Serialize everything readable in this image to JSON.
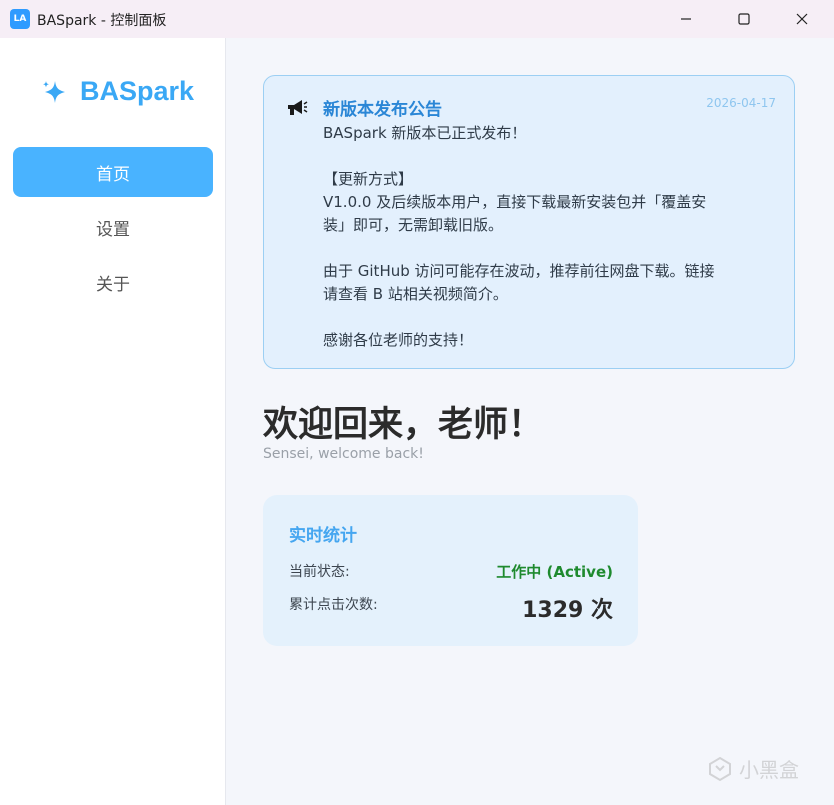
{
  "window": {
    "title": "BASpark - 控制面板",
    "app_icon_text": "LA"
  },
  "sidebar": {
    "logo": "BASpark",
    "items": [
      {
        "label": "首页",
        "active": true
      },
      {
        "label": "设置",
        "active": false
      },
      {
        "label": "关于",
        "active": false
      }
    ]
  },
  "announcement": {
    "title": "新版本发布公告",
    "date": "2026-04-17",
    "body": "BASpark 新版本已正式发布！\n\n【更新方式】\nV1.0.0 及后续版本用户，直接下载最新安装包并「覆盖安装」即可，无需卸载旧版。\n\n由于 GitHub 访问可能存在波动，推荐前往网盘下载。链接请查看 B 站相关视频简介。\n\n感谢各位老师的支持！"
  },
  "welcome": {
    "heading": "欢迎回来，老师！",
    "subtitle": "Sensei, welcome back!"
  },
  "stats": {
    "title": "实时统计",
    "status_label": "当前状态:",
    "status_value": "工作中 (Active)",
    "clicks_label": "累计点击次数:",
    "clicks_value": "1329 次"
  },
  "watermark": "小黑盒",
  "colors": {
    "accent": "#49b3ff",
    "logo": "#3aa8f5",
    "active_status": "#1e8a2e",
    "notice_bg": "#e3f0fd",
    "notice_border": "#9ccff3"
  },
  "icons": {
    "logo": "sparkle-icon",
    "announcement": "megaphone-icon",
    "minimize": "minimize-icon",
    "maximize": "maximize-icon",
    "close": "close-icon"
  }
}
